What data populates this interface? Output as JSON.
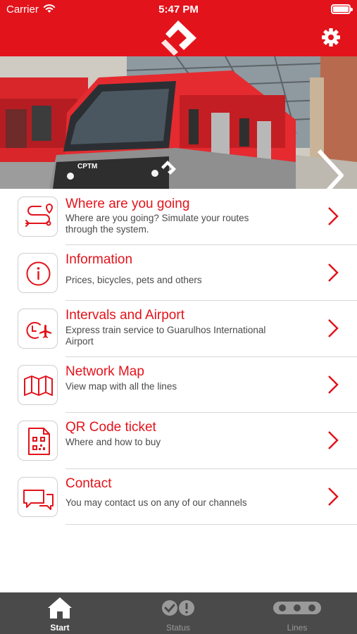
{
  "status_bar": {
    "carrier": "Carrier",
    "time": "5:47 PM"
  },
  "header": {
    "logo_icon": "cptm-logo-icon",
    "settings_icon": "gear-icon",
    "brand_color": "#e3131b"
  },
  "banner": {
    "train_text": "CPTM",
    "next_icon": "chevron-right-icon"
  },
  "menu": [
    {
      "title": "Where are you going",
      "subtitle": "Where are you going? Simulate your routes through the system.",
      "icon": "route-icon"
    },
    {
      "title": "Information",
      "subtitle": "Prices, bicycles, pets and others",
      "icon": "info-icon"
    },
    {
      "title": "Intervals and Airport",
      "subtitle": "Express train service to Guarulhos International Airport",
      "icon": "clock-airplane-icon"
    },
    {
      "title": "Network Map",
      "subtitle": "View map with all the lines",
      "icon": "map-icon"
    },
    {
      "title": "QR Code ticket",
      "subtitle": "Where and how to buy",
      "icon": "qr-ticket-icon"
    },
    {
      "title": "Contact",
      "subtitle": "You may contact us on any of our channels",
      "icon": "chat-icon"
    }
  ],
  "tabs": [
    {
      "label": "Start",
      "icon": "home-icon",
      "active": true
    },
    {
      "label": "Status",
      "icon": "status-icon",
      "active": false
    },
    {
      "label": "Lines",
      "icon": "lines-icon",
      "active": false
    }
  ]
}
